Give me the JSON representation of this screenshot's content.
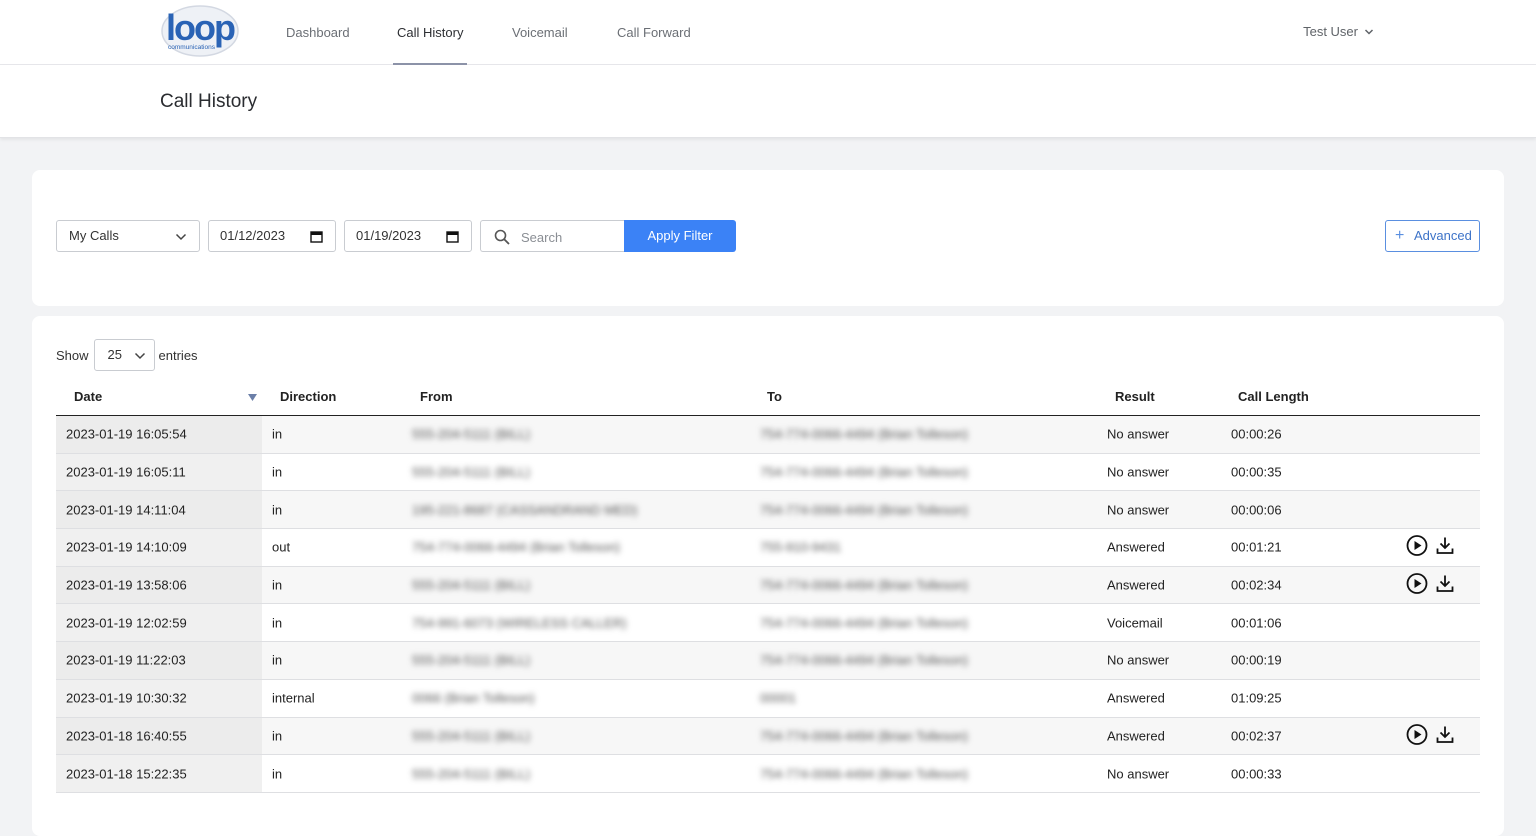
{
  "nav": {
    "logo_text": "loop",
    "logo_sub": "communications",
    "items": [
      {
        "label": "Dashboard"
      },
      {
        "label": "Call History"
      },
      {
        "label": "Voicemail"
      },
      {
        "label": "Call Forward"
      }
    ],
    "active": "Call History",
    "user": "Test User"
  },
  "page": {
    "title": "Call History"
  },
  "filters": {
    "scope": "My Calls",
    "date_from": "01/12/2023",
    "date_to": "01/19/2023",
    "search_placeholder": "Search",
    "apply_label": "Apply Filter",
    "advanced_label": "Advanced"
  },
  "table": {
    "show_label": "Show",
    "page_size": "25",
    "entries_label": "entries",
    "columns": [
      "Date",
      "Direction",
      "From",
      "To",
      "Result",
      "Call Length"
    ],
    "rows": [
      {
        "date": "2023-01-19 16:05:54",
        "direction": "in",
        "from": "555-204-5111 (BILL)",
        "to": "754-774-0066-4494 (Brian Tolleson)",
        "result": "No answer",
        "length": "00:00:26",
        "has_recording": false
      },
      {
        "date": "2023-01-19 16:05:11",
        "direction": "in",
        "from": "555-204-5111 (BILL)",
        "to": "754-774-0066-4494 (Brian Tolleson)",
        "result": "No answer",
        "length": "00:00:35",
        "has_recording": false
      },
      {
        "date": "2023-01-19 14:11:04",
        "direction": "in",
        "from": "195-221-8687 (CASSANDRAND MED)",
        "to": "754-774-0066-4494 (Brian Tolleson)",
        "result": "No answer",
        "length": "00:00:06",
        "has_recording": false
      },
      {
        "date": "2023-01-19 14:10:09",
        "direction": "out",
        "from": "754-774-0066-4494 (Brian Tolleson)",
        "to": "755-910-9431",
        "result": "Answered",
        "length": "00:01:21",
        "has_recording": true
      },
      {
        "date": "2023-01-19 13:58:06",
        "direction": "in",
        "from": "555-204-5111 (BILL)",
        "to": "754-774-0066-4494 (Brian Tolleson)",
        "result": "Answered",
        "length": "00:02:34",
        "has_recording": true
      },
      {
        "date": "2023-01-19 12:02:59",
        "direction": "in",
        "from": "754-991-6073 (WIRELESS CALLER)",
        "to": "754-774-0066-4494 (Brian Tolleson)",
        "result": "Voicemail",
        "length": "00:01:06",
        "has_recording": false
      },
      {
        "date": "2023-01-19 11:22:03",
        "direction": "in",
        "from": "555-204-5111 (BILL)",
        "to": "754-774-0066-4494 (Brian Tolleson)",
        "result": "No answer",
        "length": "00:00:19",
        "has_recording": false
      },
      {
        "date": "2023-01-19 10:30:32",
        "direction": "internal",
        "from": "0066 (Brian Tolleson)",
        "to": "00001",
        "result": "Answered",
        "length": "01:09:25",
        "has_recording": false
      },
      {
        "date": "2023-01-18 16:40:55",
        "direction": "in",
        "from": "555-204-5111 (BILL)",
        "to": "754-774-0066-4494 (Brian Tolleson)",
        "result": "Answered",
        "length": "00:02:37",
        "has_recording": true
      },
      {
        "date": "2023-01-18 15:22:35",
        "direction": "in",
        "from": "555-204-5111 (BILL)",
        "to": "754-774-0066-4494 (Brian Tolleson)",
        "result": "No answer",
        "length": "00:00:33",
        "has_recording": false
      }
    ]
  },
  "colors": {
    "accent": "#3b82f6",
    "logo": "#2a63b5"
  }
}
